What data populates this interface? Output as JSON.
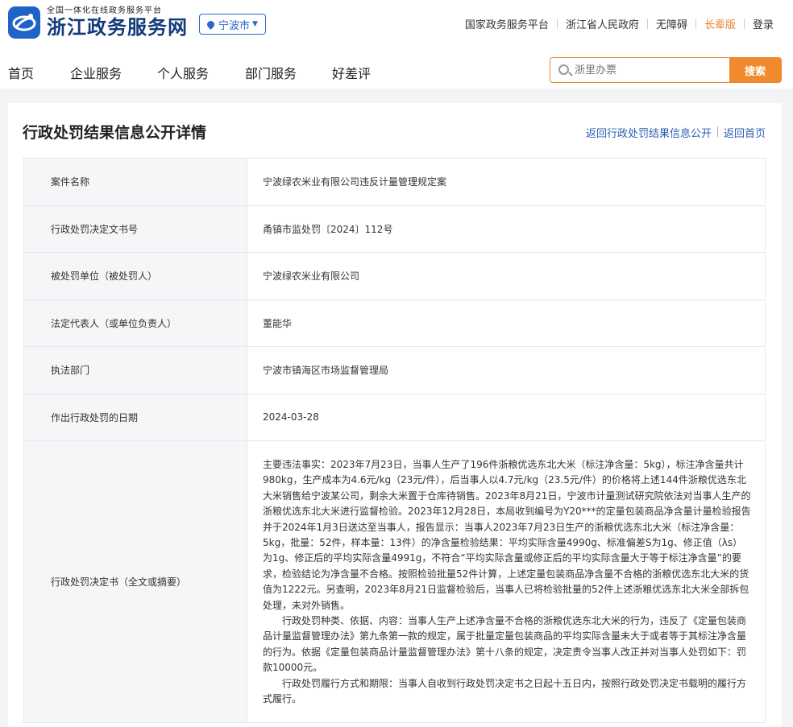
{
  "header": {
    "logo_subtitle": "全国一体化在线政务服务平台",
    "logo_title": "浙江政务服务网",
    "city": "宁波市",
    "top_links": [
      "国家政务服务平台",
      "浙江省人民政府",
      "无障碍",
      "长辈版",
      "登录"
    ]
  },
  "nav": {
    "items": [
      "首页",
      "企业服务",
      "个人服务",
      "部门服务",
      "好差评"
    ]
  },
  "search": {
    "placeholder": "浙里办票",
    "button": "搜索"
  },
  "page": {
    "title": "行政处罚结果信息公开详情",
    "back_list": "返回行政处罚结果信息公开",
    "back_home": "返回首页"
  },
  "detail": {
    "rows": [
      {
        "label": "案件名称",
        "value": "宁波绿农米业有限公司违反计量管理规定案"
      },
      {
        "label": "行政处罚决定文书号",
        "value": "甬镇市监处罚〔2024〕112号"
      },
      {
        "label": "被处罚单位（被处罚人）",
        "value": "宁波绿农米业有限公司"
      },
      {
        "label": "法定代表人（或单位负责人）",
        "value": "董能华"
      },
      {
        "label": "执法部门",
        "value": "宁波市镇海区市场监督管理局"
      },
      {
        "label": "作出行政处罚的日期",
        "value": "2024-03-28"
      }
    ],
    "decision_label": "行政处罚决定书（全文或摘要）",
    "decision_paragraphs": [
      "主要违法事实：2023年7月23日，当事人生产了196件浙粮优选东北大米（标注净含量：5kg），标注净含量共计980kg，生产成本为4.6元/kg（23元/件），后当事人以4.7元/kg（23.5元/件）的价格将上述144件浙粮优选东北大米销售给宁波某公司，剩余大米置于仓库待销售。2023年8月21日，宁波市计量测试研究院依法对当事人生产的浙粮优选东北大米进行监督检验。2023年12月28日，本局收到编号为Y20***的定量包装商品净含量计量检验报告并于2024年1月3日送达至当事人，报告显示：当事人2023年7月23日生产的浙粮优选东北大米（标注净含量：5kg，批量：52件，样本量：13件）的净含量检验结果：平均实际含量4990g、标准偏差S为1g、修正值（λs）为1g、修正后的平均实际含量4991g，不符合“平均实际含量或修正后的平均实际含量大于等于标注净含量”的要求，检验结论为净含量不合格。按照检验批量52件计算，上述定量包装商品净含量不合格的浙粮优选东北大米的货值为1222元。另查明，2023年8月21日监督检验后，当事人已将检验批量的52件上述浙粮优选东北大米全部拆包处理，未对外销售。",
      "行政处罚种类、依据、内容：当事人生产上述净含量不合格的浙粮优选东北大米的行为，违反了《定量包装商品计量监督管理办法》第九条第一款的规定，属于批量定量包装商品的平均实际含量未大于或者等于其标注净含量的行为。依据《定量包装商品计量监督管理办法》第十八条的规定，决定责令当事人改正并对当事人处罚如下：罚款10000元。",
      "行政处罚履行方式和期限：当事人自收到行政处罚决定书之日起十五日内，按照行政处罚决定书载明的履行方式履行。"
    ]
  },
  "colors": {
    "brand_blue": "#1e63c7",
    "accent_orange": "#f08a2c",
    "link_blue": "#2a5fb0"
  }
}
